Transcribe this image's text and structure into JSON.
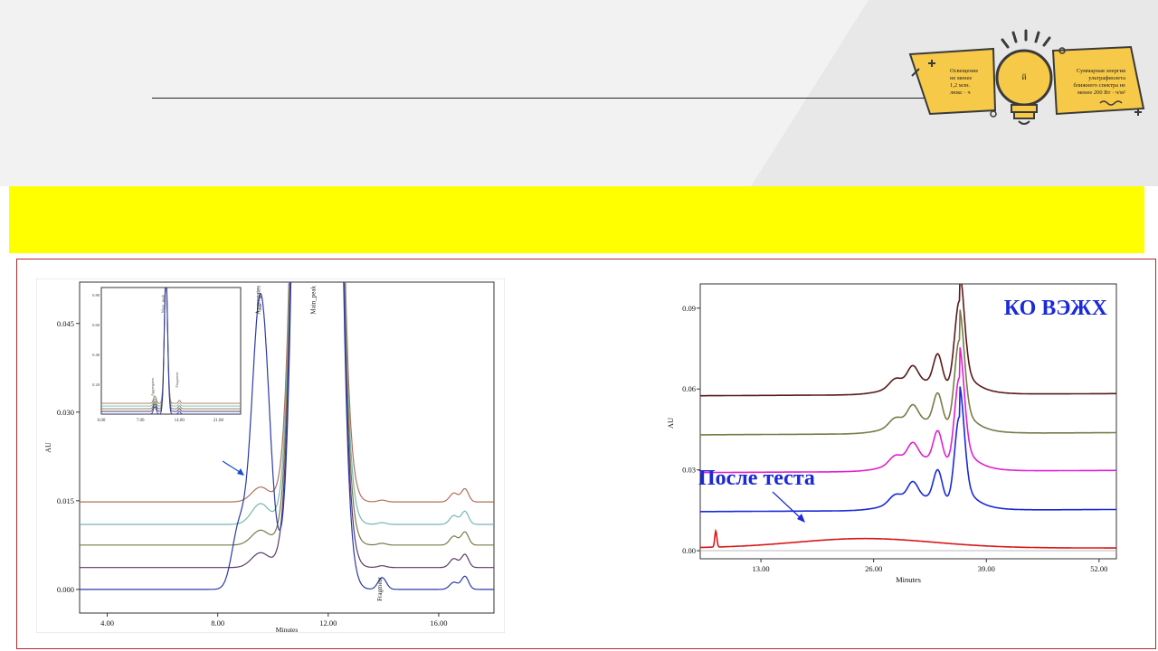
{
  "logo": {
    "left_text": [
      "Освещение",
      "не менее",
      "1,2 млн.",
      "люкс · ч"
    ],
    "right_text": [
      "Суммарная энергия",
      "ультрафиолета",
      "ближнего спектра не",
      "менее 200 Вт · ч/м²"
    ],
    "center_mark": "й",
    "colors": {
      "badge": "#f7c948",
      "outline": "#3a3a3a"
    }
  },
  "banner": {
    "color": "#ffff00"
  },
  "chart_data": [
    {
      "type": "line",
      "xlabel": "Minutes",
      "ylabel": "AU",
      "xlim": [
        3.0,
        18.0
      ],
      "ylim": [
        -0.004,
        0.052
      ],
      "x_ticks": [
        4.0,
        8.0,
        12.0,
        16.0
      ],
      "x_tick_labels": [
        "4.00",
        "8.00",
        "12.00",
        "16.00"
      ],
      "y_ticks": [
        0.0,
        0.015,
        0.03,
        0.045
      ],
      "y_tick_labels": [
        "0.000",
        "0.015",
        "0.030",
        "0.045"
      ],
      "peak_labels": [
        {
          "text": "Aggregates",
          "x": 9.6
        },
        {
          "text": "Main_peak",
          "x": 11.6
        },
        {
          "text": "Fragment",
          "x": 14.0
        }
      ],
      "series": [
        {
          "color": "#b0705a",
          "offset": 0.0148,
          "agg": 0.0025,
          "pre": 0.0,
          "frag": 0.0003,
          "p1": 0.0015
        },
        {
          "color": "#74b8b0",
          "offset": 0.011,
          "agg": 0.0035,
          "pre": 0.0,
          "frag": 0.0003,
          "p1": 0.0015
        },
        {
          "color": "#7a7a4a",
          "offset": 0.0075,
          "agg": 0.0025,
          "pre": 0.0,
          "frag": 0.0003,
          "p1": 0.0015
        },
        {
          "color": "#5a3a6a",
          "offset": 0.0037,
          "agg": 0.0025,
          "pre": 0.0,
          "frag": 0.0003,
          "p1": 0.0015
        },
        {
          "color": "#2b3aa8",
          "offset": 0.0,
          "agg": 0.05,
          "pre": 0.0095,
          "frag": 0.002,
          "p1": 0.0012
        }
      ],
      "inset": {
        "xlim": [
          0.0,
          25.0
        ],
        "ylim": [
          0.0,
          0.85
        ],
        "x_ticks": [
          0.0,
          7.0,
          14.0,
          21.0
        ],
        "x_tick_labels": [
          "0.00",
          "7.00",
          "14.00",
          "21.00"
        ],
        "y_ticks": [
          0.2,
          0.4,
          0.6,
          0.8
        ],
        "y_tick_labels": [
          "0.20",
          "0.40",
          "0.60",
          "0.80"
        ],
        "peak_labels": [
          "Aggregates",
          "Main_peak",
          "Fragment"
        ]
      }
    },
    {
      "type": "line",
      "xlabel": "Minutes",
      "ylabel": "AU",
      "xlim": [
        6.0,
        54.0
      ],
      "ylim": [
        -0.003,
        0.099
      ],
      "x_ticks": [
        13.0,
        26.0,
        39.0,
        52.0
      ],
      "x_tick_labels": [
        "13.00",
        "26.00",
        "39.00",
        "52.00"
      ],
      "y_ticks": [
        0.0,
        0.03,
        0.06,
        0.09
      ],
      "y_tick_labels": [
        "0.00",
        "0.03",
        "0.06",
        "0.09"
      ],
      "title": "КО ВЭЖХ",
      "annotation": "После теста",
      "series": [
        {
          "color": "#5a1a1a",
          "offset": 0.0575
        },
        {
          "color": "#7a7a4a",
          "offset": 0.043
        },
        {
          "color": "#e020d0",
          "offset": 0.029
        },
        {
          "color": "#1a2ad8",
          "offset": 0.0145
        },
        {
          "color": "#d81818",
          "offset": 0.001,
          "flat": true
        }
      ]
    }
  ]
}
